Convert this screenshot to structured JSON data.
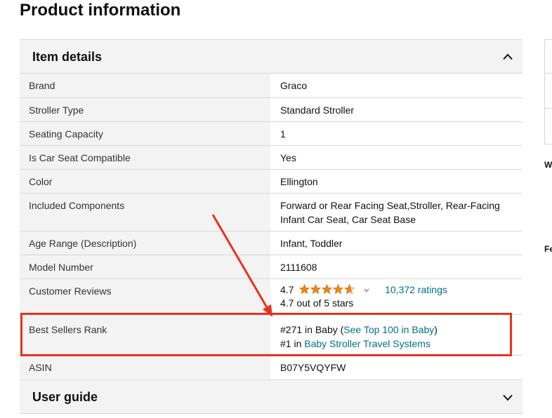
{
  "page": {
    "title": "Product information"
  },
  "item_details": {
    "header": "Item details",
    "rows": [
      {
        "key": "Brand",
        "value": "Graco"
      },
      {
        "key": "Stroller Type",
        "value": "Standard Stroller"
      },
      {
        "key": "Seating Capacity",
        "value": "1"
      },
      {
        "key": "Is Car Seat Compatible",
        "value": "Yes"
      },
      {
        "key": "Color",
        "value": "Ellington"
      },
      {
        "key": "Included Components",
        "value": "Forward or Rear Facing Seat,Stroller, Rear-Facing Infant Car Seat, Car Seat Base"
      },
      {
        "key": "Age Range (Description)",
        "value": "Infant, Toddler"
      },
      {
        "key": "Model Number",
        "value": "2111608"
      }
    ],
    "reviews": {
      "key": "Customer Reviews",
      "rating": "4.7",
      "rating_value": 4.7,
      "ratings_link": "10,372 ratings",
      "out_of": "4.7 out of 5 stars"
    },
    "best_sellers": {
      "key": "Best Sellers Rank",
      "rank1_prefix": "#271 in Baby (",
      "rank1_link": "See Top 100 in Baby",
      "rank1_suffix": ")",
      "rank2_prefix": "#1 in ",
      "rank2_link": "Baby Stroller Travel Systems"
    },
    "asin": {
      "key": "ASIN",
      "value": "B07Y5VQYFW"
    }
  },
  "user_guide": {
    "header": "User guide"
  },
  "right_fragments": [
    "W",
    "Fe"
  ],
  "icons": {
    "item_details_toggle": "chevron-up-icon",
    "user_guide_toggle": "chevron-down-icon",
    "stars": "star-rating-icon",
    "reviews_dropdown": "caret-down-icon"
  },
  "colors": {
    "link": "#007185",
    "star": "#f08804",
    "annotation": "#e8321e",
    "row_label_bg": "#f3f3f3",
    "border": "#d5d9d9"
  }
}
